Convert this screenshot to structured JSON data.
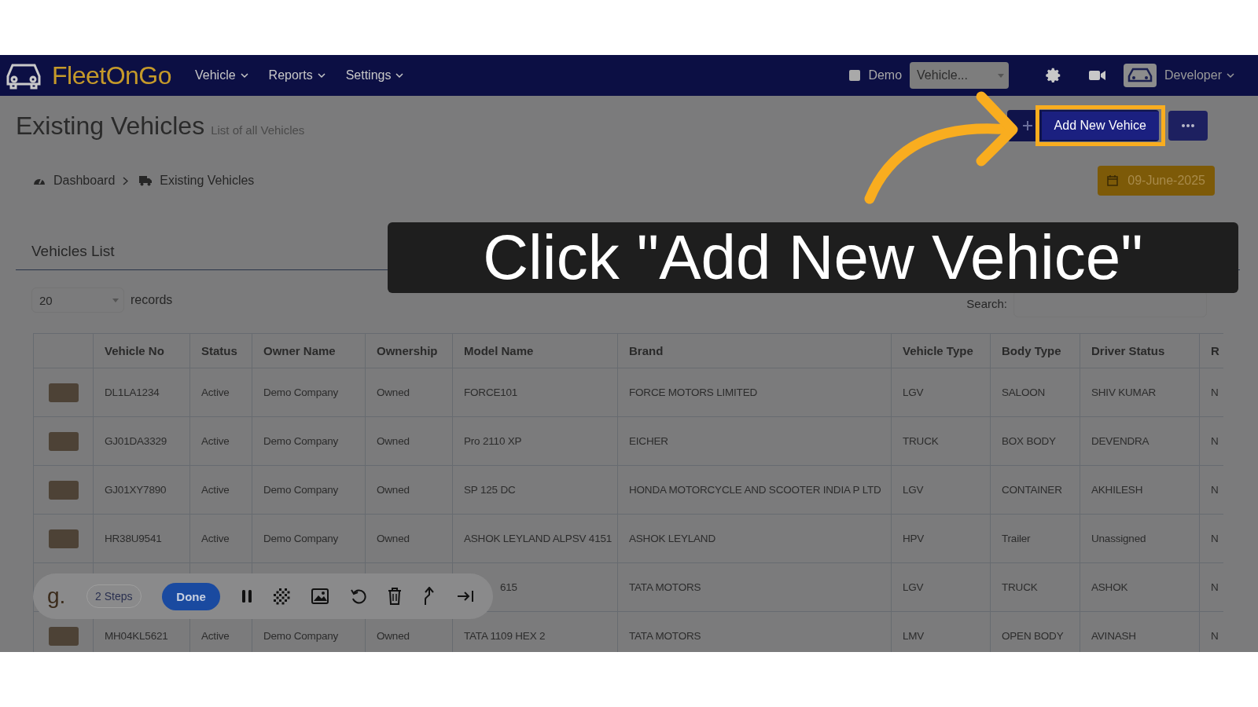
{
  "nav": {
    "logo": "FleetOnGo",
    "menu": [
      {
        "label": "Vehicle"
      },
      {
        "label": "Reports"
      },
      {
        "label": "Settings"
      }
    ],
    "demo": {
      "label": "Demo",
      "checked": false
    },
    "vehicle_select": {
      "value": "Vehicle..."
    },
    "user": {
      "name": "Developer"
    }
  },
  "page": {
    "title": "Existing Vehicles",
    "subtitle": "List of all Vehicles",
    "add_button": "Add New Vehice",
    "breadcrumb": [
      {
        "label": "Dashboard",
        "kind": "dashboard"
      },
      {
        "label": "Existing Vehicles",
        "kind": "truck"
      }
    ],
    "date": "09-June-2025"
  },
  "card": {
    "title": "Vehicles List",
    "page_size": "20",
    "records_label": "records",
    "search_label": "Search:"
  },
  "table": {
    "columns": [
      "Vehicle No",
      "Status",
      "Owner Name",
      "Ownership",
      "Model Name",
      "Brand",
      "Vehicle Type",
      "Body Type",
      "Driver Status",
      "R"
    ],
    "rows": [
      {
        "cells": [
          "DL1LA1234",
          "Active",
          "Demo Company",
          "Owned",
          "FORCE101",
          "FORCE MOTORS LIMITED",
          "LGV",
          "SALOON",
          "SHIV KUMAR",
          "N"
        ]
      },
      {
        "cells": [
          "GJ01DA3329",
          "Active",
          "Demo Company",
          "Owned",
          "Pro 2110 XP",
          "EICHER",
          "TRUCK",
          "BOX BODY",
          "DEVENDRA",
          "N"
        ]
      },
      {
        "cells": [
          "GJ01XY7890",
          "Active",
          "Demo Company",
          "Owned",
          "SP 125 DC",
          "HONDA MOTORCYCLE AND SCOOTER INDIA P LTD",
          "LGV",
          "CONTAINER",
          "AKHILESH",
          "N"
        ]
      },
      {
        "cells": [
          "HR38U9541",
          "Active",
          "Demo Company",
          "Owned",
          "ASHOK LEYLAND ALPSV 4151",
          "ASHOK LEYLAND",
          "HPV",
          "Trailer",
          "Unassigned",
          "N"
        ]
      },
      {
        "cells": [
          null,
          null,
          null,
          null,
          "615",
          "TATA MOTORS",
          "LGV",
          "TRUCK",
          "ASHOK",
          "N"
        ]
      },
      {
        "cells": [
          "MH04KL5621",
          "Active",
          "Demo Company",
          "Owned",
          "TATA 1109 HEX 2",
          "TATA MOTORS",
          "LMV",
          "OPEN BODY",
          "AVINASH",
          "N"
        ]
      }
    ]
  },
  "toolbar": {
    "logo": "g.",
    "steps": "2 Steps",
    "done": "Done"
  },
  "caption": "Click \"Add New Vehice\""
}
